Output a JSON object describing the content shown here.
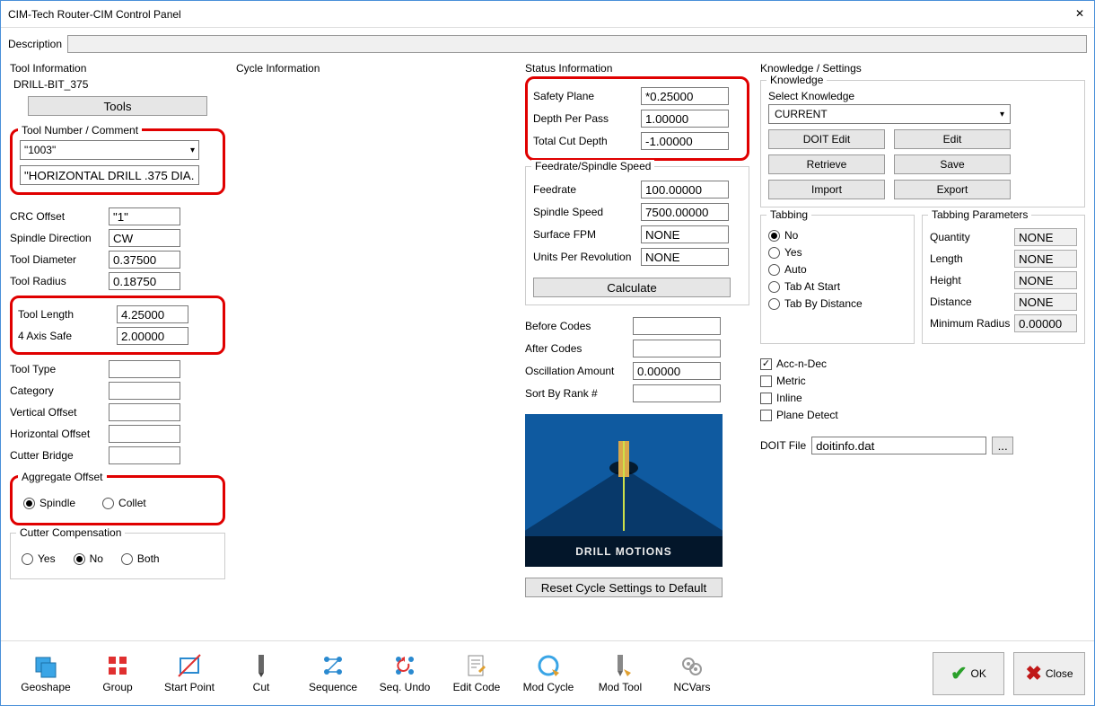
{
  "window": {
    "title": "CIM-Tech Router-CIM Control Panel"
  },
  "description": {
    "label": "Description",
    "value": ""
  },
  "toolInfo": {
    "title": "Tool Information",
    "toolName": "DRILL-BIT_375",
    "toolsBtn": "Tools",
    "toolNumGroup": "Tool Number / Comment",
    "toolNumValue": "\"1003\"",
    "commentValue": "\"HORIZONTAL DRILL .375 DIA.\"",
    "rows": {
      "crcOffset": {
        "label": "CRC Offset",
        "value": "\"1\""
      },
      "spindleDir": {
        "label": "Spindle Direction",
        "value": "CW"
      },
      "toolDia": {
        "label": "Tool Diameter",
        "value": "0.37500"
      },
      "toolRad": {
        "label": "Tool Radius",
        "value": "0.18750"
      },
      "toolLen": {
        "label": "Tool Length",
        "value": "4.25000"
      },
      "axisSafe": {
        "label": "4 Axis Safe",
        "value": "2.00000"
      },
      "toolType": {
        "label": "Tool Type",
        "value": ""
      },
      "category": {
        "label": "Category",
        "value": ""
      },
      "vOffset": {
        "label": "Vertical Offset",
        "value": ""
      },
      "hOffset": {
        "label": "Horizontal Offset",
        "value": ""
      },
      "cutterBridge": {
        "label": "Cutter Bridge",
        "value": ""
      }
    },
    "aggGroup": {
      "title": "Aggregate Offset",
      "spindle": "Spindle",
      "collet": "Collet"
    },
    "cutterComp": {
      "title": "Cutter Compensation",
      "yes": "Yes",
      "no": "No",
      "both": "Both"
    }
  },
  "cycleInfo": {
    "title": "Cycle Information"
  },
  "statusInfo": {
    "title": "Status Information",
    "safetyPlane": {
      "label": "Safety Plane",
      "value": "*0.25000"
    },
    "depthPerPass": {
      "label": "Depth Per Pass",
      "value": "1.00000"
    },
    "totalCutDepth": {
      "label": "Total Cut Depth",
      "value": "-1.00000"
    },
    "feedrateGroup": {
      "title": "Feedrate/Spindle Speed",
      "feedrate": {
        "label": "Feedrate",
        "value": "100.00000"
      },
      "spindleSpeed": {
        "label": "Spindle Speed",
        "value": "7500.00000"
      },
      "surfaceFPM": {
        "label": "Surface FPM",
        "value": "NONE"
      },
      "unitsPerRev": {
        "label": "Units Per Revolution",
        "value": "NONE"
      },
      "calculate": "Calculate"
    },
    "beforeCodes": {
      "label": "Before Codes",
      "value": ""
    },
    "afterCodes": {
      "label": "After Codes",
      "value": ""
    },
    "oscAmount": {
      "label": "Oscillation Amount",
      "value": "0.00000"
    },
    "sortRank": {
      "label": "Sort By Rank #",
      "value": ""
    },
    "previewCaption": "DRILL MOTIONS",
    "resetBtn": "Reset Cycle Settings to Default"
  },
  "knowledge": {
    "title": "Knowledge / Settings",
    "knLabel": "Knowledge",
    "selLabel": "Select Knowledge",
    "selValue": "CURRENT",
    "buttons": {
      "doitEdit": "DOIT Edit",
      "edit": "Edit",
      "retrieve": "Retrieve",
      "save": "Save",
      "import": "Import",
      "export": "Export"
    },
    "tabbing": {
      "title": "Tabbing",
      "no": "No",
      "yes": "Yes",
      "auto": "Auto",
      "tabAtStart": "Tab At Start",
      "tabByDist": "Tab By Distance"
    },
    "tabParams": {
      "title": "Tabbing Parameters",
      "quantity": {
        "label": "Quantity",
        "value": "NONE"
      },
      "length": {
        "label": "Length",
        "value": "NONE"
      },
      "height": {
        "label": "Height",
        "value": "NONE"
      },
      "distance": {
        "label": "Distance",
        "value": "NONE"
      },
      "minRadius": {
        "label": "Minimum Radius",
        "value": "0.00000"
      }
    },
    "checks": {
      "acc": "Acc-n-Dec",
      "metric": "Metric",
      "inline": "Inline",
      "plane": "Plane Detect"
    },
    "doitFile": {
      "label": "DOIT File",
      "value": "doitinfo.dat",
      "browse": "..."
    }
  },
  "footer": {
    "geoshape": "Geoshape",
    "group": "Group",
    "startPoint": "Start Point",
    "cut": "Cut",
    "sequence": "Sequence",
    "seqUndo": "Seq. Undo",
    "editCode": "Edit Code",
    "modCycle": "Mod Cycle",
    "modTool": "Mod Tool",
    "ncvars": "NCVars",
    "ok": "OK",
    "close": "Close"
  }
}
